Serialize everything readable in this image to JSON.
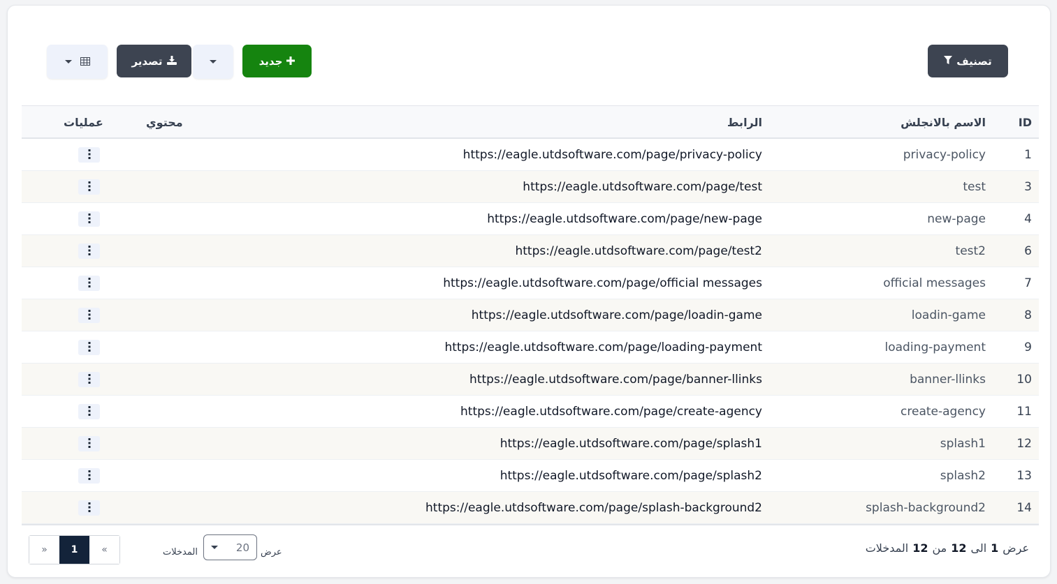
{
  "toolbar": {
    "filter_label": "تصنيف",
    "new_label": "جديد",
    "export_label": "تصدير"
  },
  "table": {
    "headers": {
      "id": "ID",
      "name": "الاسم بالانجلش",
      "url": "الرابط",
      "content": "محتوي",
      "ops": "عمليات"
    },
    "rows": [
      {
        "id": "1",
        "name": "privacy-policy",
        "url": "https://eagle.utdsoftware.com/page/privacy-policy"
      },
      {
        "id": "3",
        "name": "test",
        "url": "https://eagle.utdsoftware.com/page/test"
      },
      {
        "id": "4",
        "name": "new-page",
        "url": "https://eagle.utdsoftware.com/page/new-page"
      },
      {
        "id": "6",
        "name": "test2",
        "url": "https://eagle.utdsoftware.com/page/test2"
      },
      {
        "id": "7",
        "name": "official messages",
        "url": "https://eagle.utdsoftware.com/page/official messages"
      },
      {
        "id": "8",
        "name": "loadin-game",
        "url": "https://eagle.utdsoftware.com/page/loadin-game"
      },
      {
        "id": "9",
        "name": "loading-payment",
        "url": "https://eagle.utdsoftware.com/page/loading-payment"
      },
      {
        "id": "10",
        "name": "banner-llinks",
        "url": "https://eagle.utdsoftware.com/page/banner-llinks"
      },
      {
        "id": "11",
        "name": "create-agency",
        "url": "https://eagle.utdsoftware.com/page/create-agency"
      },
      {
        "id": "12",
        "name": "splash1",
        "url": "https://eagle.utdsoftware.com/page/splash1"
      },
      {
        "id": "13",
        "name": "splash2",
        "url": "https://eagle.utdsoftware.com/page/splash2"
      },
      {
        "id": "14",
        "name": "splash-background2",
        "url": "https://eagle.utdsoftware.com/page/splash-background2"
      }
    ]
  },
  "footer": {
    "info_show": "عرض",
    "info_from": "1",
    "info_to_word": "الى",
    "info_to": "12",
    "info_of_word": "من",
    "info_total": "12",
    "info_entries": "المدخلات",
    "length_show": "عرض",
    "length_value": "20",
    "length_entries": "المدخلات",
    "pager_prev": "«",
    "pager_current": "1",
    "pager_next": "»"
  },
  "colors": {
    "accent_dark": "#3d4451",
    "new_green": "#15840f",
    "pager_active": "#13233a"
  },
  "icons": [
    "filter-icon",
    "plus-icon",
    "chevron-down-icon",
    "download-icon",
    "table-icon",
    "kebab-icon"
  ]
}
